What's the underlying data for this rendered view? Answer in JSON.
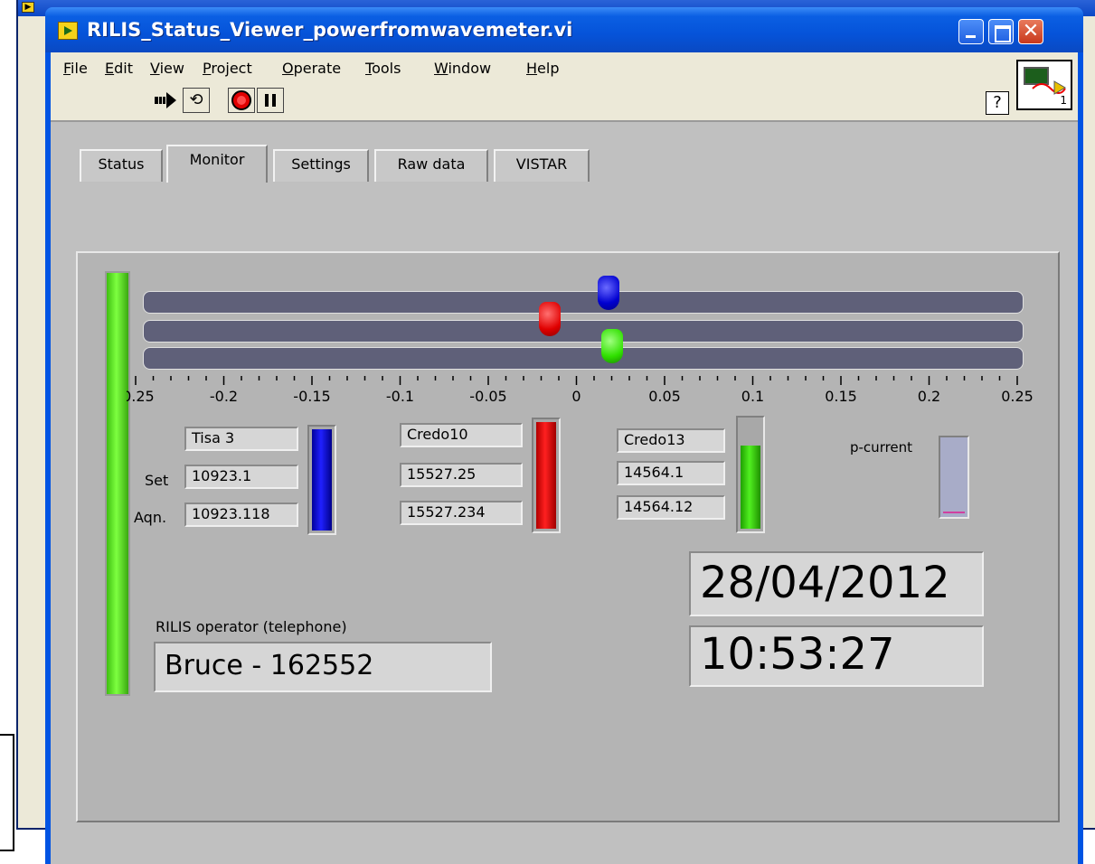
{
  "window": {
    "title": "RILIS_Status_Viewer_powerfromwavemeter.vi"
  },
  "menu": [
    "File",
    "Edit",
    "View",
    "Project",
    "Operate",
    "Tools",
    "Window",
    "Help"
  ],
  "menu_mnemonics": [
    "F",
    "E",
    "V",
    "P",
    "O",
    "T",
    "W",
    "H"
  ],
  "toolbar": {
    "help_glyph": "?",
    "vi_icon_number": "1"
  },
  "tabs": [
    {
      "label": "Status",
      "active": false
    },
    {
      "label": "Monitor",
      "active": true
    },
    {
      "label": "Settings",
      "active": false
    },
    {
      "label": "Raw data",
      "active": false
    },
    {
      "label": "VISTAR",
      "active": false
    }
  ],
  "slider": {
    "min": -0.25,
    "max": 0.25,
    "tick_labels": [
      "-0.25",
      "-0.2",
      "-0.15",
      "-0.1",
      "-0.05",
      "0",
      "0.05",
      "0.1",
      "0.15",
      "0.2",
      "0.25"
    ],
    "blue_value": 0.018,
    "red_value": -0.015,
    "green_value": 0.02
  },
  "lasers": {
    "row_labels": {
      "set": "Set",
      "aqn": "Aqn."
    },
    "tisa3": {
      "name": "Tisa 3",
      "set": "10923.1",
      "aqn": "10923.118",
      "level": 1.0,
      "color": "#0000ff"
    },
    "credo10": {
      "name": "Credo10",
      "set": "15527.25",
      "aqn": "15527.234",
      "level": 1.0,
      "color": "#ff0000"
    },
    "credo13": {
      "name": "Credo13",
      "set": "14564.1",
      "aqn": "14564.12",
      "level": 0.78,
      "color": "#40e010"
    }
  },
  "p_current": {
    "label": "p-current",
    "level": 0.0
  },
  "operator": {
    "label": "RILIS operator (telephone)",
    "value": "Bruce - 162552"
  },
  "datetime": {
    "date": "28/04/2012",
    "time": "10:53:27"
  }
}
